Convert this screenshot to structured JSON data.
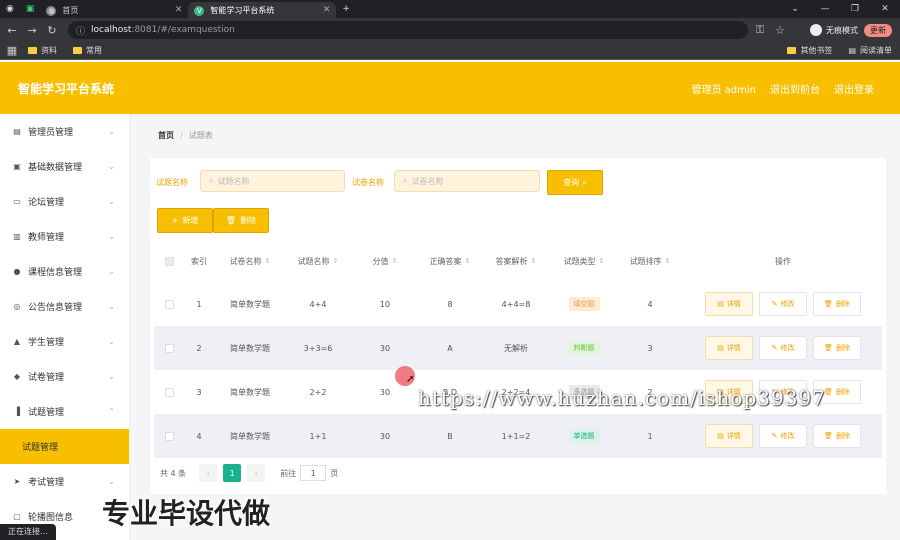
{
  "browser": {
    "tabs": [
      {
        "title": "首页",
        "active": false
      },
      {
        "title": "智能学习平台系统",
        "active": true
      }
    ],
    "new_tab": "+",
    "url_host": "localhost",
    "url_rest": ":8081/#/examquestion",
    "incognito_label": "无痕模式",
    "update_label": "更新",
    "bookmarks": [
      "资料",
      "常用"
    ],
    "bookmarks_right": [
      "其他书签",
      "阅读清单"
    ],
    "status": "正在连接..."
  },
  "header": {
    "title": "智能学习平台系统",
    "user": "管理员 admin",
    "links": [
      "退出到前台",
      "退出登录"
    ]
  },
  "sidebar": {
    "items": [
      {
        "label": "管理员管理",
        "icon": "briefcase-icon",
        "glyph": "▤",
        "chev": "⌄"
      },
      {
        "label": "基础数据管理",
        "icon": "clipboard-icon",
        "glyph": "▣",
        "chev": "⌄"
      },
      {
        "label": "论坛管理",
        "icon": "chat-icon",
        "glyph": "▭",
        "chev": "⌄"
      },
      {
        "label": "教师管理",
        "icon": "chart-icon",
        "glyph": "▥",
        "chev": "⌄"
      },
      {
        "label": "课程信息管理",
        "icon": "user-icon",
        "glyph": "●",
        "chev": "⌄"
      },
      {
        "label": "公告信息管理",
        "icon": "compass-icon",
        "glyph": "◎",
        "chev": "⌄"
      },
      {
        "label": "学生管理",
        "icon": "graduation-icon",
        "glyph": "▲",
        "chev": "⌄"
      },
      {
        "label": "试卷管理",
        "icon": "location-icon",
        "glyph": "◆",
        "chev": "⌄"
      },
      {
        "label": "试题管理",
        "icon": "bar-chart-icon",
        "glyph": "▐",
        "chev": "⌃"
      },
      {
        "label": "试题管理",
        "icon": "",
        "glyph": "",
        "chev": "",
        "active": true
      },
      {
        "label": "考试管理",
        "icon": "send-icon",
        "glyph": "➤",
        "chev": "⌄"
      },
      {
        "label": "轮播图信息",
        "icon": "image-icon",
        "glyph": "▢",
        "chev": ""
      }
    ]
  },
  "breadcrumb": {
    "home": "首页",
    "sep": "/",
    "current": "试题表"
  },
  "filters": {
    "label1": "试题名称",
    "placeholder1": "试题名称",
    "label2": "试卷名称",
    "placeholder2": "试卷名称",
    "search_label": "查询"
  },
  "toolbar": {
    "add_label": "新增",
    "delete_label": "删除"
  },
  "table": {
    "headers": [
      "索引",
      "试卷名称",
      "试题名称",
      "分值",
      "正确答案",
      "答案解析",
      "试题类型",
      "试题排序",
      "操作"
    ],
    "rows": [
      {
        "index": "1",
        "paper": "简单数学题",
        "question": "4+4",
        "score": "10",
        "answer": "8",
        "analysis": "4+4=8",
        "type": "填空题",
        "order": "4"
      },
      {
        "index": "2",
        "paper": "简单数学题",
        "question": "3+3=6",
        "score": "30",
        "answer": "A",
        "analysis": "无解析",
        "type": "判断题",
        "order": "3"
      },
      {
        "index": "3",
        "paper": "简单数学题",
        "question": "2+2",
        "score": "30",
        "answer": "B,D",
        "analysis": "2+2=4",
        "type": "多选题",
        "order": "2"
      },
      {
        "index": "4",
        "paper": "简单数学题",
        "question": "1+1",
        "score": "30",
        "answer": "B",
        "analysis": "1+1=2",
        "type": "单选题",
        "order": "1"
      }
    ],
    "actions": [
      "详情",
      "修改",
      "删除"
    ],
    "type_colors": {
      "填空题": "#fdebd3",
      "判断题": "#e1f3d8",
      "多选题": "#e9e9eb",
      "单选题": "#d9f2ea"
    },
    "type_text_colors": {
      "填空题": "#e6a23c",
      "判断题": "#67c23a",
      "多选题": "#909399",
      "单选题": "#1fae7d"
    }
  },
  "pager": {
    "total": "共 4 条",
    "prev": "‹",
    "current": "1",
    "next": "›",
    "goto": "前往",
    "goto_value": "1",
    "page_unit": "页"
  },
  "watermark": "https://www.huzhan.com/ishop39397",
  "overlay_text": "专业毕设代做",
  "colors": {
    "accent": "#f8bf00",
    "pager_active": "#18b38c"
  }
}
